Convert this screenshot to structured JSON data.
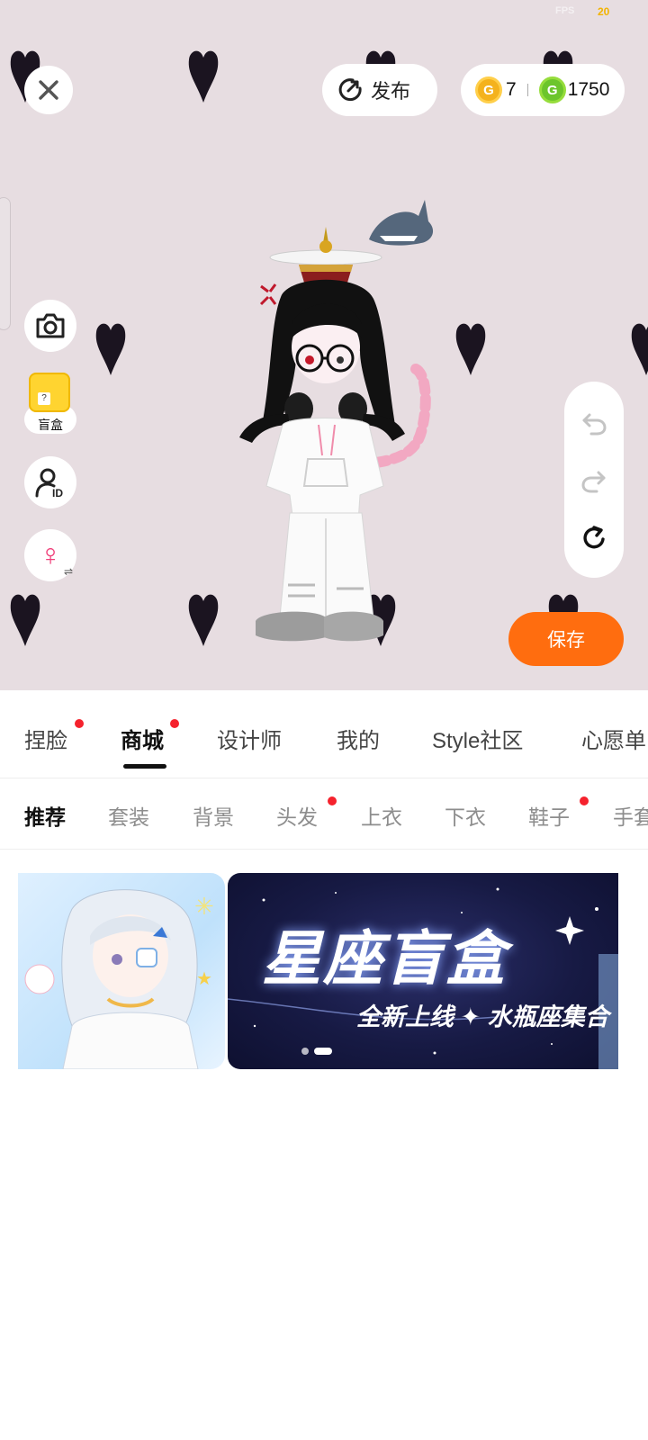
{
  "status": {
    "fps_label": "FPS",
    "fps_value": "20"
  },
  "top_bar": {
    "publish_label": "发布",
    "coin_gold_value": "7",
    "coin_green_value": "1750"
  },
  "left_tools": {
    "blindbox_label": "盲盒",
    "gender_symbol": "♀"
  },
  "save_label": "保存",
  "main_tabs": [
    {
      "label": "捏脸",
      "dot": true
    },
    {
      "label": "商城",
      "dot": true,
      "active": true
    },
    {
      "label": "设计师"
    },
    {
      "label": "我的"
    },
    {
      "label": "Style社区"
    },
    {
      "label": "心愿单"
    }
  ],
  "sub_tabs": [
    {
      "label": "推荐",
      "active": true
    },
    {
      "label": "套装"
    },
    {
      "label": "背景"
    },
    {
      "label": "头发",
      "dot": true
    },
    {
      "label": "上衣"
    },
    {
      "label": "下衣"
    },
    {
      "label": "鞋子",
      "dot": true
    },
    {
      "label": "手套"
    }
  ],
  "banner": {
    "title": "星座盲盒",
    "subtitle": "全新上线 ✦ 水瓶座集合",
    "page_count": 2,
    "current_page": 2
  },
  "colors": {
    "accent": "#ff6d0f",
    "stage_bg": "#e7dde1",
    "badge_dot": "#f5222d"
  }
}
